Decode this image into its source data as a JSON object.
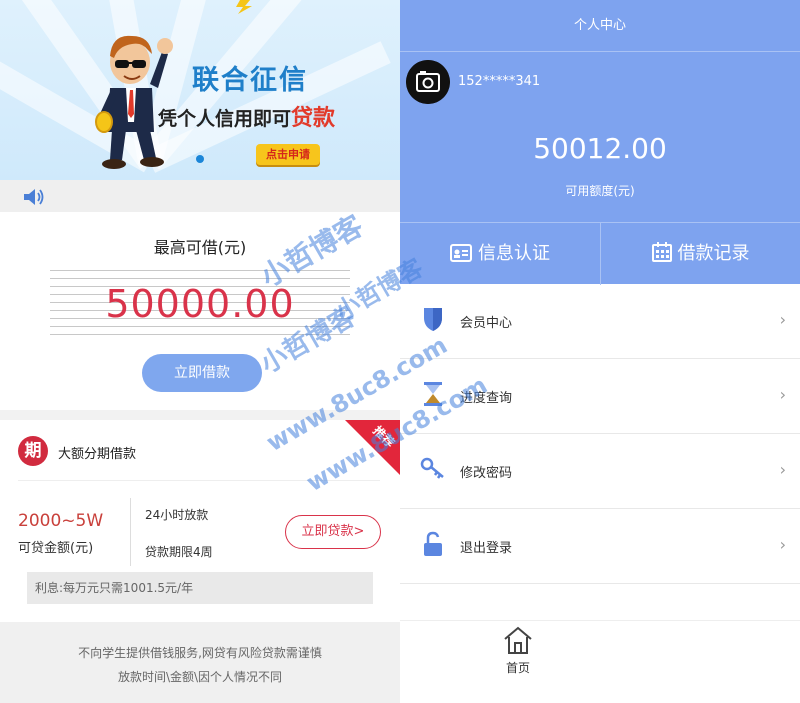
{
  "left": {
    "banner": {
      "title": "联合征信",
      "subtitle_prefix": "凭个人信用即可",
      "subtitle_highlight": "贷款",
      "cta": "点击申请"
    },
    "loan": {
      "label": "最高可借(元)",
      "amount": "50000.00",
      "button": "立即借款"
    },
    "product": {
      "badge": "期",
      "title": "大额分期借款",
      "corner_tag": "推荐",
      "amount_range": "2000~5W",
      "amount_label": "可贷金额(元)",
      "feature_1": "24小时放款",
      "feature_2": "贷款期限4周",
      "apply_button": "立即贷款>",
      "interest": "利息:每万元只需1001.5元/年"
    },
    "footer": {
      "line_1": "不向学生提供借钱服务,网贷有风险贷款需谨慎",
      "line_2": "放款时间\\金额\\因个人情况不同"
    }
  },
  "right": {
    "header_title": "个人中心",
    "phone": "152*****341",
    "balance": "50012.00",
    "balance_label": "可用额度(元)",
    "actions": [
      {
        "label": "信息认证",
        "icon": "id-card-icon"
      },
      {
        "label": "借款记录",
        "icon": "calendar-icon"
      }
    ],
    "menu": [
      {
        "label": "会员中心",
        "icon": "shield-icon"
      },
      {
        "label": "进度查询",
        "icon": "hourglass-icon"
      },
      {
        "label": "修改密码",
        "icon": "key-icon"
      },
      {
        "label": "退出登录",
        "icon": "unlock-icon"
      }
    ],
    "menu_chevron": "›",
    "tab_home": "首页"
  },
  "watermark": {
    "text_1": "小哲博客",
    "text_2": "www.8uc8.com"
  },
  "colors": {
    "accent_blue": "#7ea3ef",
    "accent_red": "#d9334a",
    "banner_blue": "#1f7fc9"
  }
}
